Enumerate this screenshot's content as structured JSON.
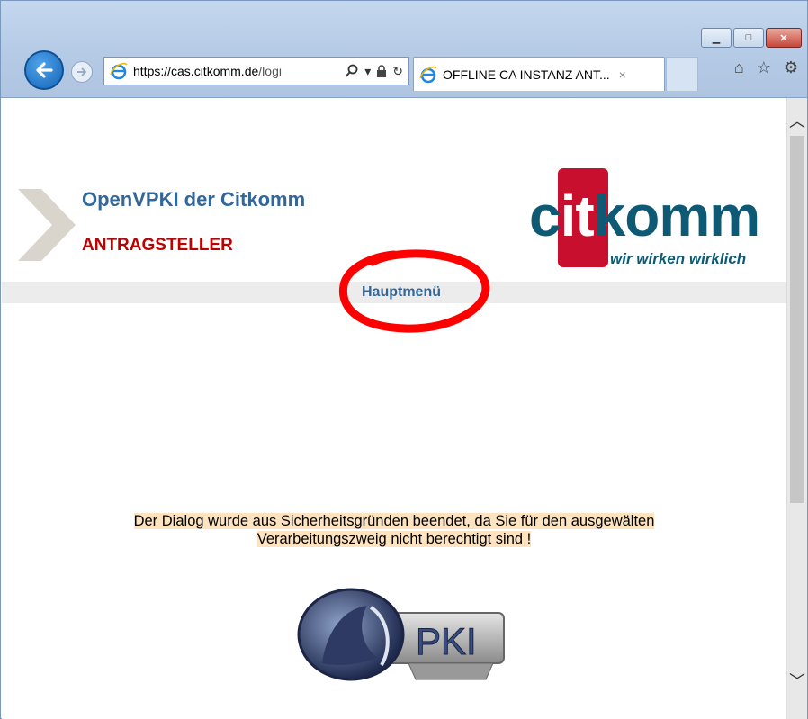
{
  "browser": {
    "address": {
      "url_host": "https://cas.citkomm.de",
      "url_rest": "/logi"
    },
    "tab": {
      "title": "OFFLINE CA INSTANZ ANT...",
      "close": "×"
    },
    "window_buttons": {
      "minimize": "▁",
      "maximize": "□",
      "close": "✕"
    },
    "icons": [
      "back-icon",
      "forward-icon",
      "ie-icon",
      "search-icon",
      "lock-icon",
      "refresh-icon",
      "home-icon",
      "favorites-icon",
      "gear-icon"
    ]
  },
  "header": {
    "title": "OpenVPKI der Citkomm",
    "role": "ANTRAGSTELLER",
    "logo": {
      "wordmark_left": "c",
      "wordmark_red": "it",
      "wordmark_right": "komm",
      "tagline": "wir wirken wirklich"
    }
  },
  "menu": {
    "main_link": "Hauptmenü"
  },
  "message": {
    "line1": "Der Dialog wurde aus Sicherheitsgründen beendet, da Sie für den ausgewälten",
    "line2": "Verarbeitungszweig nicht berechtigt sind !"
  },
  "footer_logo": {
    "text": "PKI"
  },
  "colors": {
    "title_blue": "#336699",
    "role_red": "#c00000",
    "brand_red": "#c8102e",
    "brand_teal": "#0e5a75",
    "message_bg": "#fde3c0",
    "annotation_red": "#ff0000"
  }
}
